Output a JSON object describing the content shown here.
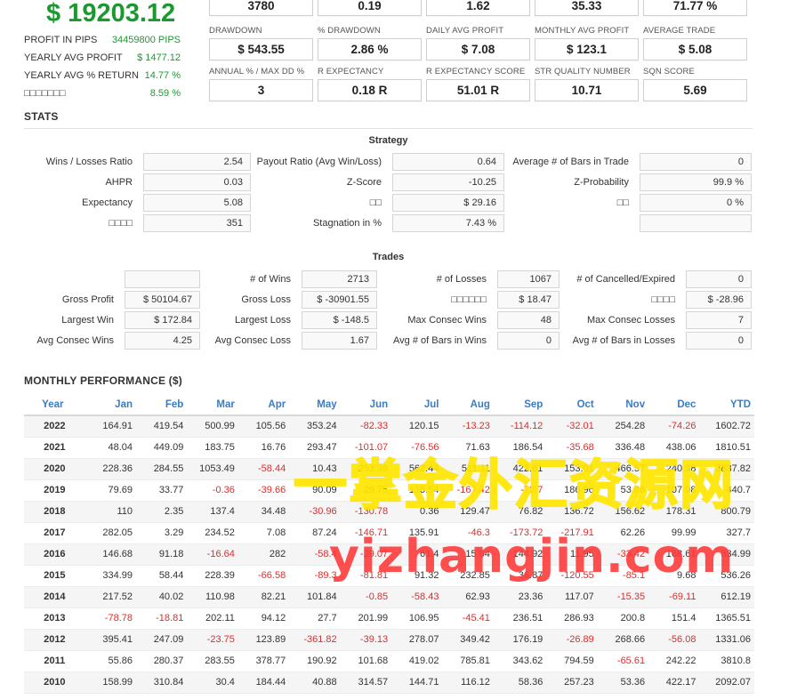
{
  "summary": {
    "profit": "$ 19203.12",
    "stats": [
      {
        "label": "PROFIT IN PIPS",
        "value": "34459800 PIPS"
      },
      {
        "label": "YEARLY AVG PROFIT",
        "value": "$ 1477.12"
      },
      {
        "label": "YEARLY AVG % RETURN",
        "value": "14.77 %"
      },
      {
        "label": "□□□□□□□",
        "value": "8.59 %"
      }
    ]
  },
  "kpi_top": [
    "3780",
    "0.19",
    "1.62",
    "35.33",
    "71.77 %"
  ],
  "kpi_row1": [
    {
      "label": "DRAWDOWN",
      "value": "$ 543.55"
    },
    {
      "label": "% DRAWDOWN",
      "value": "2.86 %"
    },
    {
      "label": "DAILY AVG PROFIT",
      "value": "$ 7.08"
    },
    {
      "label": "MONTHLY AVG PROFIT",
      "value": "$ 123.1"
    },
    {
      "label": "AVERAGE TRADE",
      "value": "$ 5.08"
    }
  ],
  "kpi_row2": [
    {
      "label": "ANNUAL % / MAX DD %",
      "value": "3"
    },
    {
      "label": "R EXPECTANCY",
      "value": "0.18 R"
    },
    {
      "label": "R EXPECTANCY SCORE",
      "value": "51.01 R"
    },
    {
      "label": "STR QUALITY NUMBER",
      "value": "10.71"
    },
    {
      "label": "SQN SCORE",
      "value": "5.69"
    }
  ],
  "stats": {
    "title": "STATS",
    "strategy": {
      "title": "Strategy",
      "rows": [
        [
          {
            "label": "Wins / Losses Ratio",
            "value": "2.54"
          },
          {
            "label": "Payout Ratio (Avg Win/Loss)",
            "value": "0.64"
          },
          {
            "label": "Average # of Bars in Trade",
            "value": "0"
          }
        ],
        [
          {
            "label": "AHPR",
            "value": "0.03"
          },
          {
            "label": "Z-Score",
            "value": "-10.25"
          },
          {
            "label": "Z-Probability",
            "value": "99.9 %"
          }
        ],
        [
          {
            "label": "Expectancy",
            "value": "5.08"
          },
          {
            "label": "□□",
            "value": "$ 29.16"
          },
          {
            "label": "□□",
            "value": "0 %"
          }
        ],
        [
          {
            "label": "□□□□",
            "value": "351"
          },
          {
            "label": "Stagnation in %",
            "value": "7.43 %"
          },
          {
            "label": "",
            "value": ""
          }
        ]
      ]
    },
    "trades": {
      "title": "Trades",
      "rows": [
        [
          {
            "label": "",
            "value": ""
          },
          {
            "label": "# of Wins",
            "value": "2713"
          },
          {
            "label": "# of Losses",
            "value": "1067"
          },
          {
            "label": "# of Cancelled/Expired",
            "value": "0"
          }
        ],
        [
          {
            "label": "Gross Profit",
            "value": "$ 50104.67"
          },
          {
            "label": "Gross Loss",
            "value": "$ -30901.55"
          },
          {
            "label": "□□□□□□",
            "value": "$ 18.47"
          },
          {
            "label": "□□□□",
            "value": "$ -28.96"
          }
        ],
        [
          {
            "label": "Largest Win",
            "value": "$ 172.84"
          },
          {
            "label": "Largest Loss",
            "value": "$ -148.5"
          },
          {
            "label": "Max Consec Wins",
            "value": "48"
          },
          {
            "label": "Max Consec Losses",
            "value": "7"
          }
        ],
        [
          {
            "label": "Avg Consec Wins",
            "value": "4.25"
          },
          {
            "label": "Avg Consec Loss",
            "value": "1.67"
          },
          {
            "label": "Avg # of Bars in Wins",
            "value": "0"
          },
          {
            "label": "Avg # of Bars in Losses",
            "value": "0"
          }
        ]
      ]
    }
  },
  "monthly": {
    "title": "MONTHLY PERFORMANCE ($)",
    "headers": [
      "Year",
      "Jan",
      "Feb",
      "Mar",
      "Apr",
      "May",
      "Jun",
      "Jul",
      "Aug",
      "Sep",
      "Oct",
      "Nov",
      "Dec",
      "YTD"
    ],
    "rows": [
      [
        "2022",
        "164.91",
        "419.54",
        "500.99",
        "105.56",
        "353.24",
        "-82.33",
        "120.15",
        "-13.23",
        "-114.12",
        "-32.01",
        "254.28",
        "-74.26",
        "1602.72"
      ],
      [
        "2021",
        "48.04",
        "449.09",
        "183.75",
        "16.76",
        "293.47",
        "-101.07",
        "-76.56",
        "71.63",
        "186.54",
        "-35.68",
        "336.48",
        "438.06",
        "1810.51"
      ],
      [
        "2020",
        "228.36",
        "284.55",
        "1053.49",
        "-58.44",
        "10.43",
        "253.36",
        "562.44",
        "511.11",
        "422.61",
        "153.01",
        "466.57",
        "240.38",
        "3837.82"
      ],
      [
        "2019",
        "79.69",
        "33.77",
        "-0.36",
        "-39.66",
        "90.09",
        "29.75",
        "135.54",
        "-167.42",
        "-72.7",
        "186.96",
        "53.86",
        "107.08",
        "440.7"
      ],
      [
        "2018",
        "110",
        "2.35",
        "137.4",
        "34.48",
        "-30.96",
        "-130.78",
        "0.36",
        "129.47",
        "76.82",
        "136.72",
        "156.62",
        "178.31",
        "800.79"
      ],
      [
        "2017",
        "282.05",
        "3.29",
        "234.52",
        "7.08",
        "87.24",
        "-146.71",
        "135.91",
        "-46.3",
        "-173.72",
        "-217.91",
        "62.26",
        "99.99",
        "327.7"
      ],
      [
        "2016",
        "146.68",
        "91.18",
        "-16.64",
        "282",
        "-58.4",
        "-29.07",
        "61.4",
        "15.64",
        "144.92",
        "11.95",
        "-33.42",
        "168.61",
        "834.99"
      ],
      [
        "2015",
        "334.99",
        "58.44",
        "228.39",
        "-66.58",
        "-89.3",
        "-81.81",
        "91.32",
        "232.85",
        "36.87",
        "-120.55",
        "-85.1",
        "9.68",
        "536.26"
      ],
      [
        "2014",
        "217.52",
        "40.02",
        "110.98",
        "82.21",
        "101.84",
        "-0.85",
        "-58.43",
        "62.93",
        "23.36",
        "117.07",
        "-15.35",
        "-69.11",
        "612.19"
      ],
      [
        "2013",
        "-78.78",
        "-18.81",
        "202.11",
        "94.12",
        "27.7",
        "201.99",
        "106.95",
        "-45.41",
        "236.51",
        "286.93",
        "200.8",
        "151.4",
        "1365.51"
      ],
      [
        "2012",
        "395.41",
        "247.09",
        "-23.75",
        "123.89",
        "-361.82",
        "-39.13",
        "278.07",
        "349.42",
        "176.19",
        "-26.89",
        "268.66",
        "-56.08",
        "1331.06"
      ],
      [
        "2011",
        "55.86",
        "280.37",
        "283.55",
        "378.77",
        "190.92",
        "101.68",
        "419.02",
        "785.81",
        "343.62",
        "794.59",
        "-65.61",
        "242.22",
        "3810.8"
      ],
      [
        "2010",
        "158.99",
        "310.84",
        "30.4",
        "184.44",
        "40.88",
        "314.57",
        "144.71",
        "116.12",
        "58.36",
        "257.23",
        "53.36",
        "422.17",
        "2092.07"
      ]
    ]
  },
  "watermark": {
    "line1": "一掌金外汇资源网",
    "line2": "yizhangjin.com"
  },
  "colors": {
    "profit_green": "#1a9a2e",
    "negative_red": "#e32b2b",
    "header_blue": "#3b7cc1"
  }
}
